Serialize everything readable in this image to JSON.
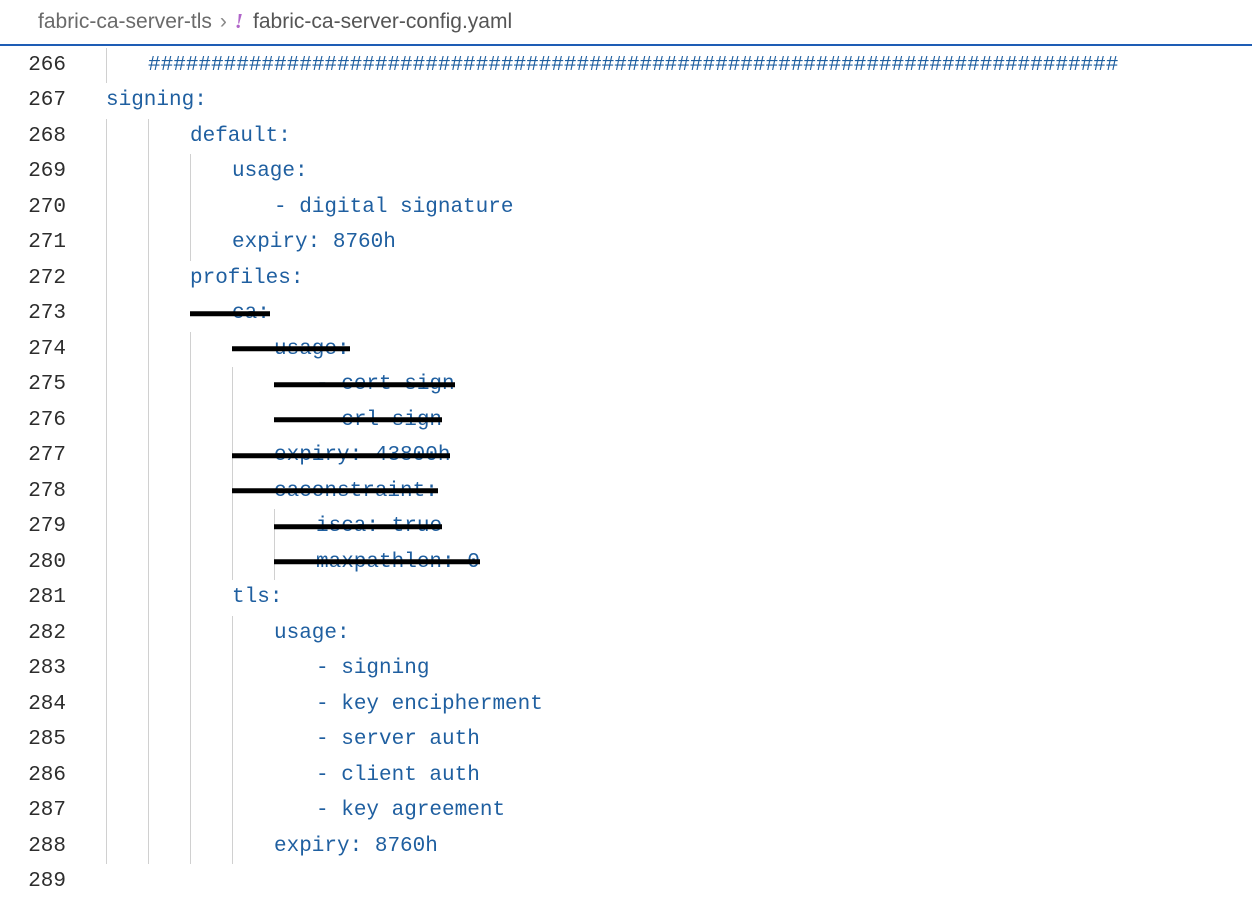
{
  "breadcrumb": {
    "folder": "fabric-ca-server-tls",
    "separator": "›",
    "file": "fabric-ca-server-config.yaml"
  },
  "lines": [
    {
      "n": 266,
      "indent": 1,
      "guides": [
        1
      ],
      "strike": false,
      "segs": [
        {
          "t": "#############################################################################",
          "c": "hash"
        }
      ]
    },
    {
      "n": 267,
      "indent": 0,
      "guides": [],
      "strike": false,
      "segs": [
        {
          "t": "signing",
          "c": "key"
        },
        {
          "t": ":",
          "c": "punct"
        }
      ]
    },
    {
      "n": 268,
      "indent": 2,
      "guides": [
        1,
        2
      ],
      "strike": false,
      "segs": [
        {
          "t": "default",
          "c": "key"
        },
        {
          "t": ":",
          "c": "punct"
        }
      ]
    },
    {
      "n": 269,
      "indent": 3,
      "guides": [
        1,
        2,
        3
      ],
      "strike": false,
      "segs": [
        {
          "t": "usage",
          "c": "key"
        },
        {
          "t": ":",
          "c": "punct"
        }
      ]
    },
    {
      "n": 270,
      "indent": 4,
      "guides": [
        1,
        2,
        3
      ],
      "strike": false,
      "segs": [
        {
          "t": "-",
          "c": "punct"
        },
        {
          "t": " ",
          "c": "punct"
        },
        {
          "t": "digital signature",
          "c": "str"
        }
      ]
    },
    {
      "n": 271,
      "indent": 3,
      "guides": [
        1,
        2,
        3
      ],
      "strike": false,
      "segs": [
        {
          "t": "expiry",
          "c": "key"
        },
        {
          "t": ":",
          "c": "punct"
        },
        {
          "t": " ",
          "c": "punct"
        },
        {
          "t": "8760h",
          "c": "num"
        }
      ]
    },
    {
      "n": 272,
      "indent": 2,
      "guides": [
        1,
        2
      ],
      "strike": false,
      "segs": [
        {
          "t": "profiles",
          "c": "key"
        },
        {
          "t": ":",
          "c": "punct"
        }
      ]
    },
    {
      "n": 273,
      "indent": 3,
      "guides": [
        1,
        2
      ],
      "strike": true,
      "segs": [
        {
          "t": "ca",
          "c": "key"
        },
        {
          "t": ":",
          "c": "punct"
        }
      ]
    },
    {
      "n": 274,
      "indent": 4,
      "guides": [
        1,
        2,
        3
      ],
      "strike": true,
      "segs": [
        {
          "t": "usage",
          "c": "key"
        },
        {
          "t": ":",
          "c": "punct"
        }
      ]
    },
    {
      "n": 275,
      "indent": 5,
      "guides": [
        1,
        2,
        3,
        4
      ],
      "strike": true,
      "segs": [
        {
          "t": "-",
          "c": "punct"
        },
        {
          "t": " ",
          "c": "punct"
        },
        {
          "t": "cert sign",
          "c": "str"
        }
      ]
    },
    {
      "n": 276,
      "indent": 5,
      "guides": [
        1,
        2,
        3,
        4
      ],
      "strike": true,
      "segs": [
        {
          "t": "-",
          "c": "punct"
        },
        {
          "t": " ",
          "c": "punct"
        },
        {
          "t": "crl sign",
          "c": "str"
        }
      ]
    },
    {
      "n": 277,
      "indent": 4,
      "guides": [
        1,
        2,
        3,
        4
      ],
      "strike": true,
      "segs": [
        {
          "t": "expiry",
          "c": "key"
        },
        {
          "t": ":",
          "c": "punct"
        },
        {
          "t": " ",
          "c": "punct"
        },
        {
          "t": "43800h",
          "c": "num"
        }
      ]
    },
    {
      "n": 278,
      "indent": 4,
      "guides": [
        1,
        2,
        3,
        4
      ],
      "strike": true,
      "segs": [
        {
          "t": "caconstraint",
          "c": "key"
        },
        {
          "t": ":",
          "c": "punct"
        }
      ]
    },
    {
      "n": 279,
      "indent": 5,
      "guides": [
        1,
        2,
        3,
        4,
        5
      ],
      "strike": true,
      "segs": [
        {
          "t": "isca",
          "c": "key"
        },
        {
          "t": ":",
          "c": "punct"
        },
        {
          "t": " ",
          "c": "punct"
        },
        {
          "t": "true",
          "c": "bool"
        }
      ]
    },
    {
      "n": 280,
      "indent": 5,
      "guides": [
        1,
        2,
        3,
        4,
        5
      ],
      "strike": true,
      "segs": [
        {
          "t": "maxpathlen",
          "c": "key"
        },
        {
          "t": ":",
          "c": "punct"
        },
        {
          "t": " ",
          "c": "punct"
        },
        {
          "t": "0",
          "c": "num"
        }
      ]
    },
    {
      "n": 281,
      "indent": 3,
      "guides": [
        1,
        2,
        3
      ],
      "strike": false,
      "segs": [
        {
          "t": "tls",
          "c": "key"
        },
        {
          "t": ":",
          "c": "punct"
        }
      ]
    },
    {
      "n": 282,
      "indent": 4,
      "guides": [
        1,
        2,
        3,
        4
      ],
      "strike": false,
      "segs": [
        {
          "t": "usage",
          "c": "key"
        },
        {
          "t": ":",
          "c": "punct"
        }
      ]
    },
    {
      "n": 283,
      "indent": 5,
      "guides": [
        1,
        2,
        3,
        4
      ],
      "strike": false,
      "segs": [
        {
          "t": "-",
          "c": "punct"
        },
        {
          "t": " ",
          "c": "punct"
        },
        {
          "t": "signing",
          "c": "str"
        }
      ]
    },
    {
      "n": 284,
      "indent": 5,
      "guides": [
        1,
        2,
        3,
        4
      ],
      "strike": false,
      "segs": [
        {
          "t": "-",
          "c": "punct"
        },
        {
          "t": " ",
          "c": "punct"
        },
        {
          "t": "key encipherment",
          "c": "str"
        }
      ]
    },
    {
      "n": 285,
      "indent": 5,
      "guides": [
        1,
        2,
        3,
        4
      ],
      "strike": false,
      "segs": [
        {
          "t": "-",
          "c": "punct"
        },
        {
          "t": " ",
          "c": "punct"
        },
        {
          "t": "server auth",
          "c": "str"
        }
      ]
    },
    {
      "n": 286,
      "indent": 5,
      "guides": [
        1,
        2,
        3,
        4
      ],
      "strike": false,
      "segs": [
        {
          "t": "-",
          "c": "punct"
        },
        {
          "t": " ",
          "c": "punct"
        },
        {
          "t": "client auth",
          "c": "str"
        }
      ]
    },
    {
      "n": 287,
      "indent": 5,
      "guides": [
        1,
        2,
        3,
        4
      ],
      "strike": false,
      "segs": [
        {
          "t": "-",
          "c": "punct"
        },
        {
          "t": " ",
          "c": "punct"
        },
        {
          "t": "key agreement",
          "c": "str"
        }
      ]
    },
    {
      "n": 288,
      "indent": 4,
      "guides": [
        1,
        2,
        3,
        4
      ],
      "strike": false,
      "segs": [
        {
          "t": "expiry",
          "c": "key"
        },
        {
          "t": ":",
          "c": "punct"
        },
        {
          "t": " ",
          "c": "punct"
        },
        {
          "t": "8760h",
          "c": "num"
        }
      ]
    },
    {
      "n": 289,
      "indent": 0,
      "guides": [],
      "strike": false,
      "segs": []
    }
  ]
}
